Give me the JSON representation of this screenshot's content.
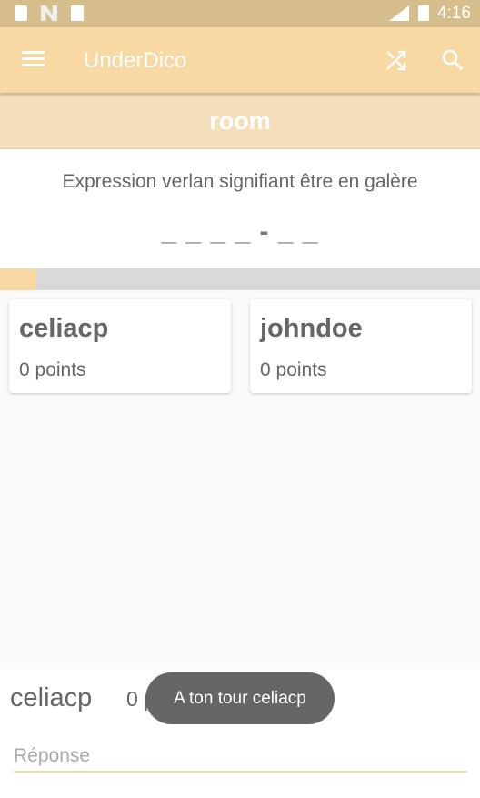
{
  "status_bar": {
    "time": "4:16",
    "icons": [
      "sd-card-icon",
      "n-icon",
      "a-icon",
      "lte-signal-icon",
      "battery-charging-icon"
    ]
  },
  "app_bar": {
    "title": "UnderDico",
    "icons": [
      "menu-icon",
      "shuffle-icon",
      "search-icon"
    ]
  },
  "room": {
    "name": "room"
  },
  "question": {
    "definition": "Expression verlan signifiant être en galère",
    "hint": "_ _ _ _ - _ _"
  },
  "progress": {
    "percent": 7.6
  },
  "players": [
    {
      "name": "celiacp",
      "points": "0 points"
    },
    {
      "name": "johndoe",
      "points": "0 points"
    }
  ],
  "current": {
    "name": "celiacp",
    "points": "0 points"
  },
  "answer": {
    "placeholder": "Réponse",
    "value": ""
  },
  "toast": "A ton tour celiacp",
  "colors": {
    "primary": "#f8d9a4",
    "status": "#d5bd8c",
    "room": "#f5deba"
  }
}
